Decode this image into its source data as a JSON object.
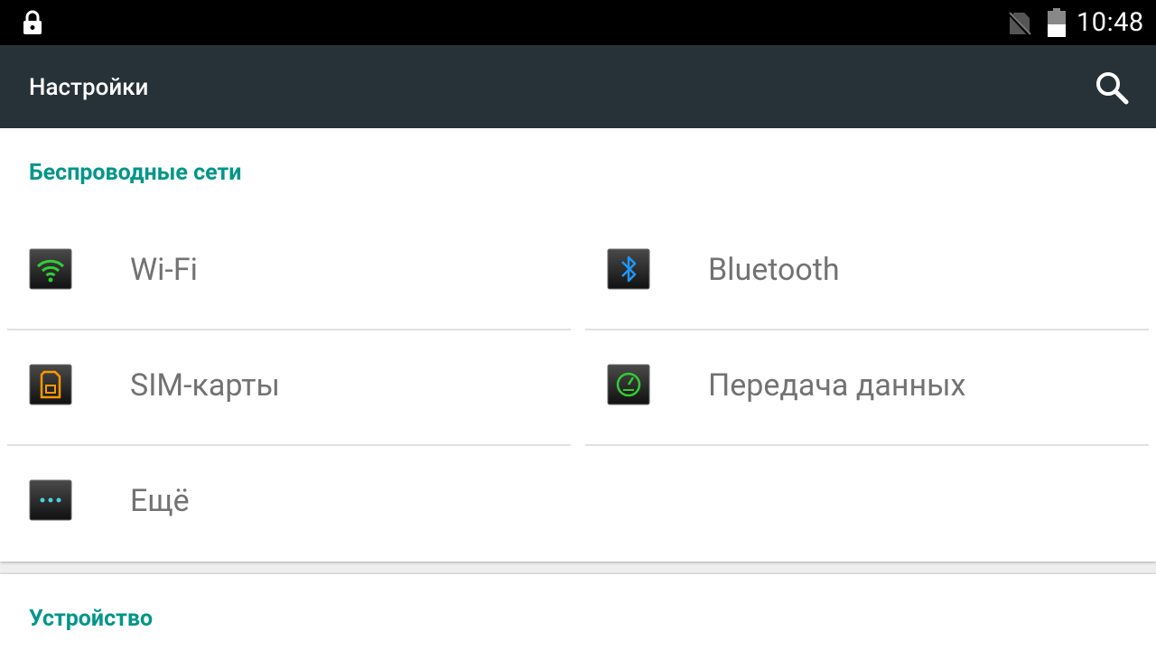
{
  "status_bar": {
    "time": "10:48",
    "icons": [
      "lock-icon",
      "no-sim-icon",
      "battery-icon"
    ]
  },
  "app_bar": {
    "title": "Настройки",
    "search_icon": "search-icon"
  },
  "sections": [
    {
      "title": "Беспроводные сети",
      "items": [
        {
          "label": "Wi-Fi",
          "icon": "wifi-icon",
          "accent": "#33cc33"
        },
        {
          "label": "Bluetooth",
          "icon": "bluetooth-icon",
          "accent": "#2196f3"
        },
        {
          "label": "SIM-карты",
          "icon": "sim-card-icon",
          "accent": "#ff9800"
        },
        {
          "label": "Передача данных",
          "icon": "data-usage-icon",
          "accent": "#33cc33"
        },
        {
          "label": "Ещё",
          "icon": "more-icon",
          "accent": "#4dd0e1"
        }
      ]
    },
    {
      "title": "Устройство",
      "items": []
    }
  ],
  "colors": {
    "status_bar": "#000000",
    "app_bar": "#263238",
    "section_title": "#009688",
    "item_text": "#727272",
    "background": "#eeeeee"
  }
}
